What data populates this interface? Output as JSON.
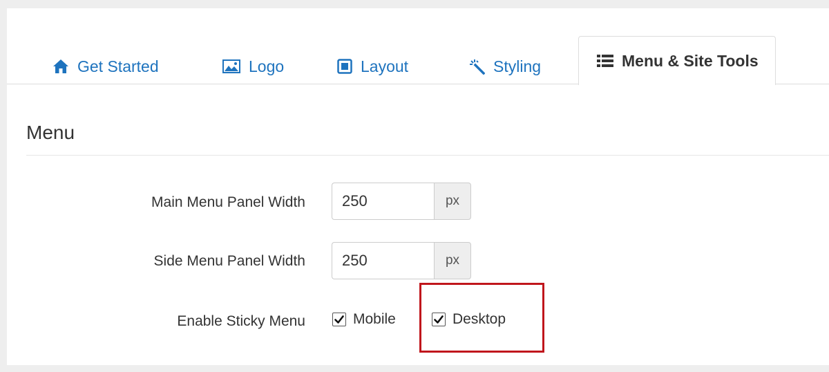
{
  "tabs": [
    {
      "label": "Get Started",
      "icon": "home-icon",
      "active": false
    },
    {
      "label": "Logo",
      "icon": "image-icon",
      "active": false
    },
    {
      "label": "Layout",
      "icon": "layout-icon",
      "active": false
    },
    {
      "label": "Styling",
      "icon": "magic-wand-icon",
      "active": false
    },
    {
      "label": "Menu & Site Tools",
      "icon": "list-icon",
      "active": true
    }
  ],
  "section": {
    "title": "Menu"
  },
  "fields": {
    "main_menu_width": {
      "label": "Main Menu Panel Width",
      "value": "250",
      "unit": "px"
    },
    "side_menu_width": {
      "label": "Side Menu Panel Width",
      "value": "250",
      "unit": "px"
    },
    "sticky_menu": {
      "label": "Enable Sticky Menu",
      "options": [
        {
          "label": "Mobile",
          "checked": true
        },
        {
          "label": "Desktop",
          "checked": true
        }
      ]
    }
  },
  "colors": {
    "link": "#1e73be",
    "highlight": "#c0161c"
  }
}
